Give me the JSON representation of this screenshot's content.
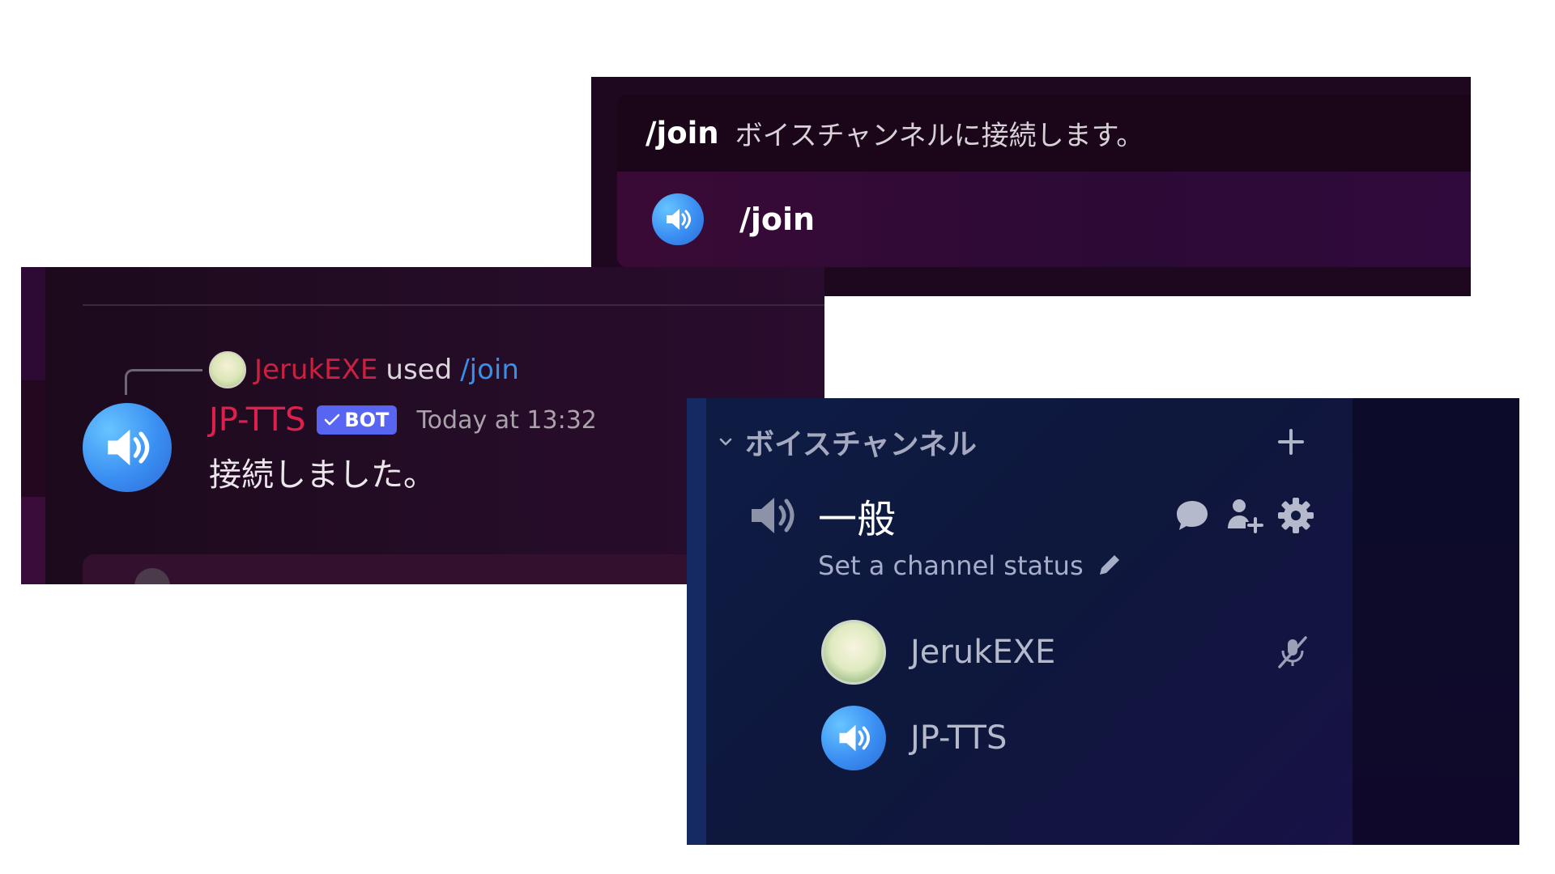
{
  "command_popup": {
    "command": "/join",
    "description": "ボイスチャンネルに接続します。",
    "option_label": "/join",
    "option_icon": "speaker-icon"
  },
  "chat": {
    "reply": {
      "user": "JerukEXE",
      "used_text": "used",
      "command": "/join"
    },
    "message": {
      "author": "JP-TTS",
      "badge": "BOT",
      "timestamp": "Today at 13:32",
      "text": "接続しました。"
    },
    "colors": {
      "reply_user": "#c9213f",
      "author": "#e0204c",
      "command_link": "#3b8ee8",
      "badge_bg": "#5865f2"
    }
  },
  "voice_sidebar": {
    "category": "ボイスチャンネル",
    "channel": {
      "name": "一般",
      "status_placeholder": "Set a channel status",
      "actions": [
        "chat-bubble-icon",
        "add-member-icon",
        "gear-icon"
      ]
    },
    "members": [
      {
        "name": "JerukEXE",
        "avatar": "anime-avatar",
        "muted": true
      },
      {
        "name": "JP-TTS",
        "avatar": "speaker-avatar",
        "muted": false
      }
    ]
  }
}
